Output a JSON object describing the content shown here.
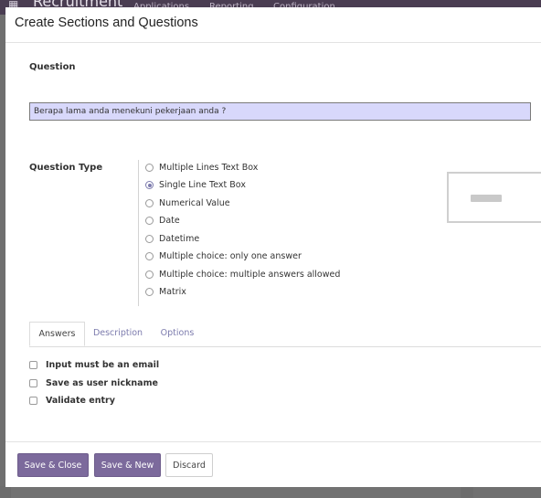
{
  "background": {
    "app_title": "Recruitment",
    "menu": [
      "Applications",
      "Reporting",
      "Configuration"
    ]
  },
  "modal": {
    "title": "Create Sections and Questions"
  },
  "question": {
    "label": "Question",
    "value": "Berapa lama anda menekuni pekerjaan anda ?"
  },
  "question_type": {
    "label": "Question Type",
    "selected_index": 1,
    "options": [
      "Multiple Lines Text Box",
      "Single Line Text Box",
      "Numerical Value",
      "Date",
      "Datetime",
      "Multiple choice: only one answer",
      "Multiple choice: multiple answers allowed",
      "Matrix"
    ]
  },
  "tabs": {
    "items": [
      "Answers",
      "Description",
      "Options"
    ],
    "active_index": 0
  },
  "answers": {
    "checkboxes": [
      {
        "label": "Input must be an email",
        "checked": false
      },
      {
        "label": "Save as user nickname",
        "checked": false
      },
      {
        "label": "Validate entry",
        "checked": false
      }
    ]
  },
  "footer": {
    "save_close": "Save & Close",
    "save_new": "Save & New",
    "discard": "Discard"
  },
  "colors": {
    "accent": "#7c6a9c",
    "input_bg": "#d8d8fb",
    "nav_bg": "#4a3d52"
  }
}
